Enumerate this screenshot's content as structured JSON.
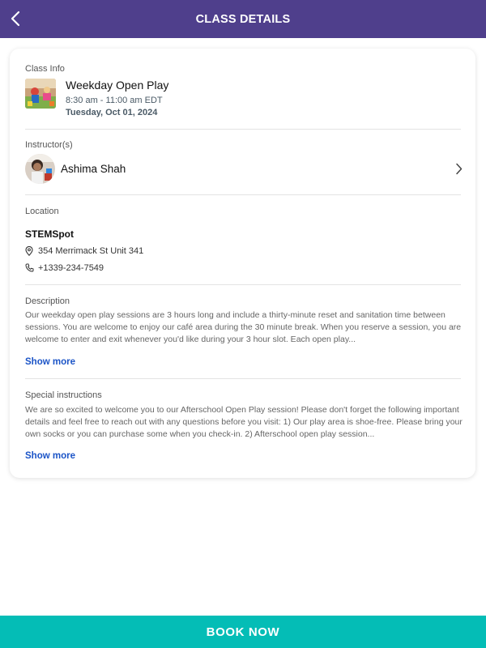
{
  "header": {
    "title": "CLASS DETAILS"
  },
  "class_info": {
    "label": "Class Info",
    "title": "Weekday Open Play",
    "time": "8:30 am - 11:00 am EDT",
    "date": "Tuesday, Oct 01, 2024"
  },
  "instructors": {
    "label": "Instructor(s)",
    "name": "Ashima Shah"
  },
  "location": {
    "label": "Location",
    "name": "STEMSpot",
    "address": "354 Merrimack St Unit 341",
    "phone": "+1339-234-7549"
  },
  "description": {
    "label": "Description",
    "text": "Our weekday open play sessions are 3 hours long and include a thirty-minute reset and sanitation time between sessions.  You are welcome to enjoy our café area during the 30 minute break.  When you reserve a session, you are welcome to enter and exit whenever you'd like during your 3 hour slot.     Each open play...",
    "show_more": "Show more"
  },
  "special_instructions": {
    "label": "Special instructions",
    "text": "We are so excited to welcome you to our Afterschool Open Play session! Please don't forget the following important details and feel free to reach out with any questions before you visit: 1) Our play area is shoe-free. Please bring your own socks or you can purchase some when you check-in. 2) Afterschool open play session...",
    "show_more": "Show more"
  },
  "book_button": {
    "label": "BOOK NOW"
  },
  "colors": {
    "header": "#4f3f8c",
    "book_button": "#04bdb6",
    "link": "#1b54c7"
  },
  "icons": [
    "chevron-left-icon",
    "chevron-right-icon",
    "location-pin-icon",
    "phone-icon"
  ]
}
